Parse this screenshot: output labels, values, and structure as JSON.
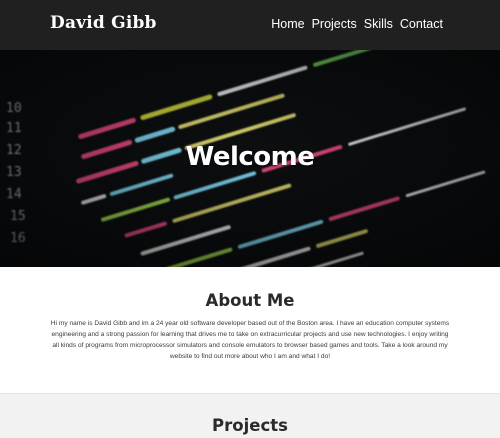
{
  "nav": {
    "brand": "David Gibb",
    "links": [
      "Home",
      "Projects",
      "Skills",
      "Contact"
    ]
  },
  "hero": {
    "title": "Welcome",
    "background": "blurred source code image"
  },
  "about": {
    "heading": "About Me",
    "text": "Hi my name is David Gibb and im a 24 year old software developer based out of the Boston area. I have an education computer systems engineering and a strong passion for learning that drives me to take on extracurricular projects and use new technologies. I enjoy writing all kinds of programs from microprocessor simulators and console emulators to browser based games and tools. Take a look around my website to find out more about who I am and what I do!"
  },
  "projects": {
    "heading": "Projects"
  },
  "colors": {
    "nav_bg": "#202020",
    "hero_bg": "#0b0d0f",
    "section_alt_bg": "#f2f2f2",
    "heading_text": "#2a2a2a"
  }
}
